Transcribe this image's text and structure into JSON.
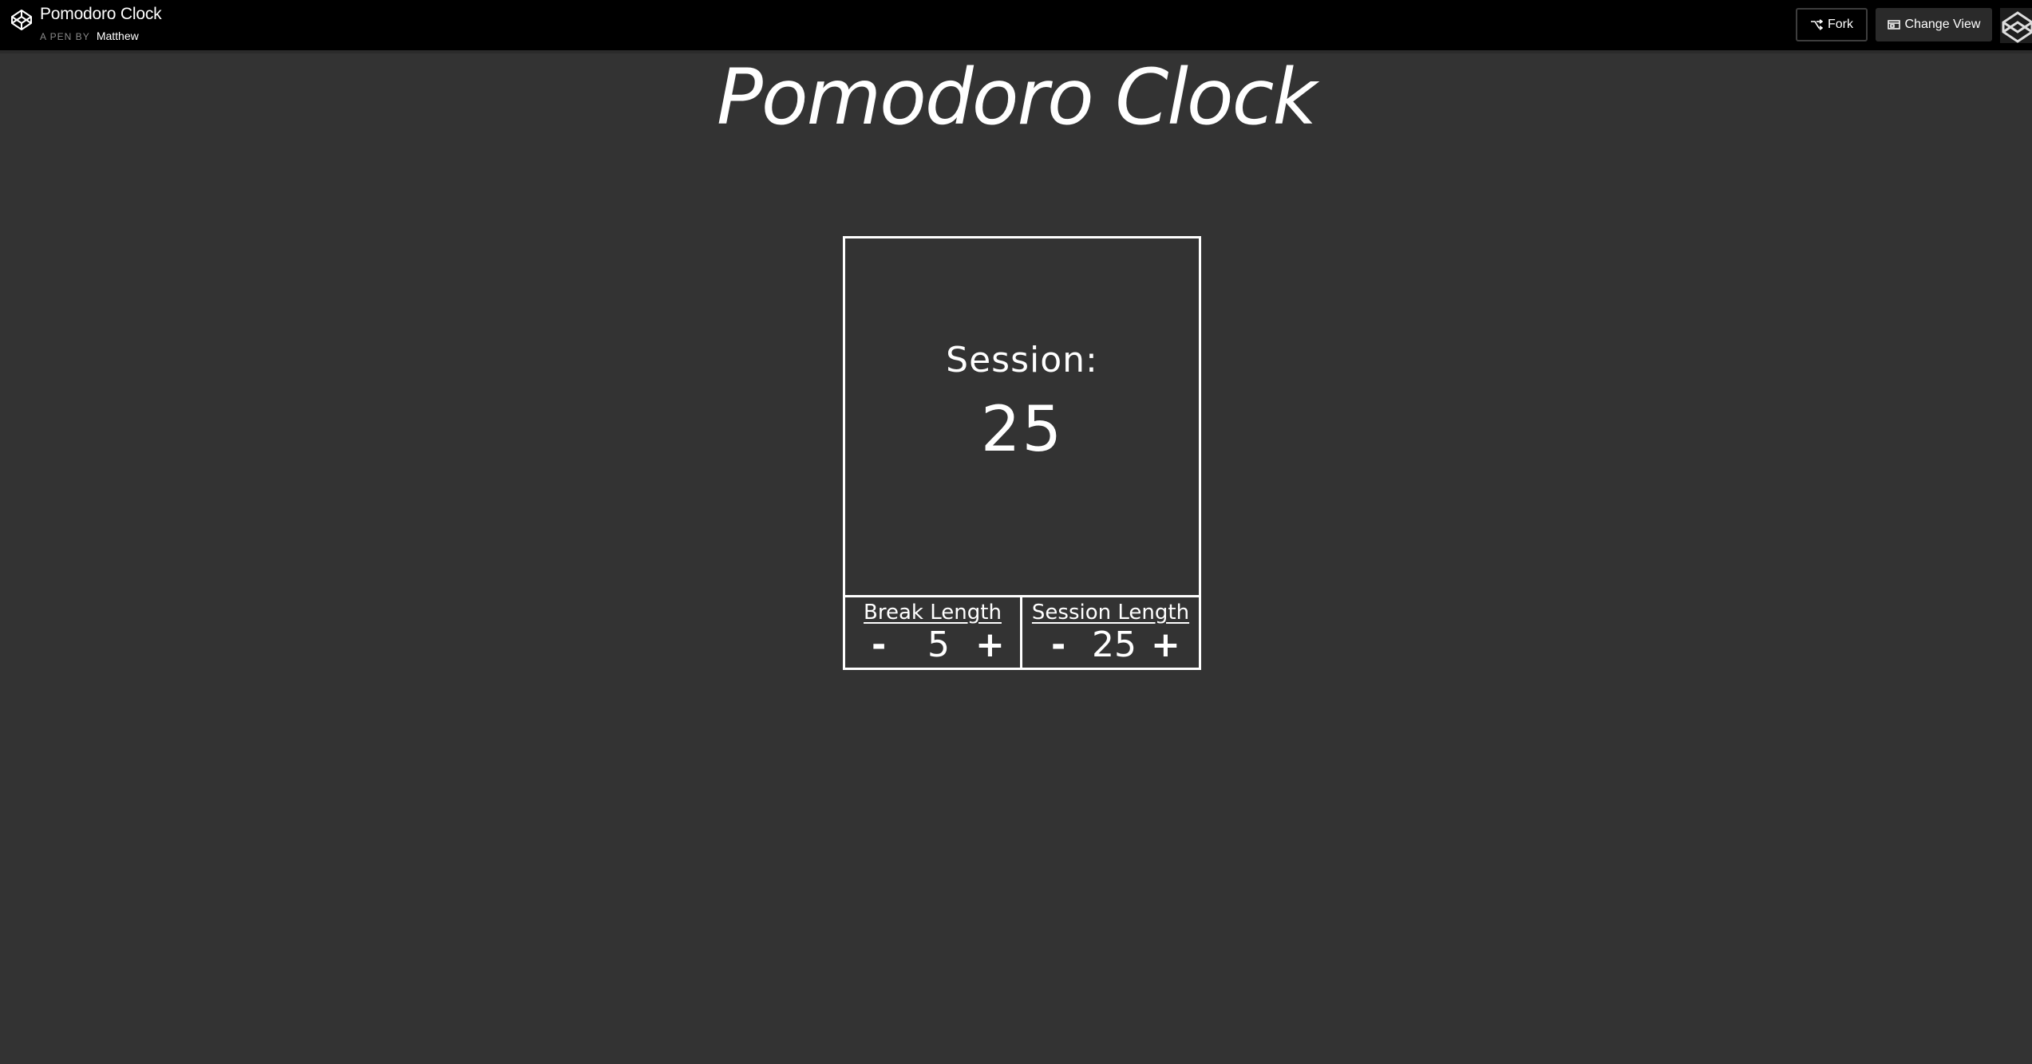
{
  "topbar": {
    "title": "Pomodoro Clock",
    "byline": "A PEN BY",
    "author": "Matthew",
    "fork_label": "Fork",
    "change_view_label": "Change View",
    "icons": [
      "codepen-logo-icon",
      "fork-icon",
      "change-view-icon",
      "avatar-icon"
    ]
  },
  "page": {
    "title": "Pomodoro Clock"
  },
  "clock": {
    "session_label": "Session:",
    "session_time": "25"
  },
  "controls": {
    "break": {
      "label": "Break Length",
      "minus": "-",
      "value": "5",
      "plus": "+"
    },
    "session": {
      "label": "Session Length",
      "minus": "-",
      "value": "25",
      "plus": "+"
    }
  },
  "colors": {
    "background": "#333333",
    "topbar": "#000000",
    "foreground": "#ffffff"
  }
}
